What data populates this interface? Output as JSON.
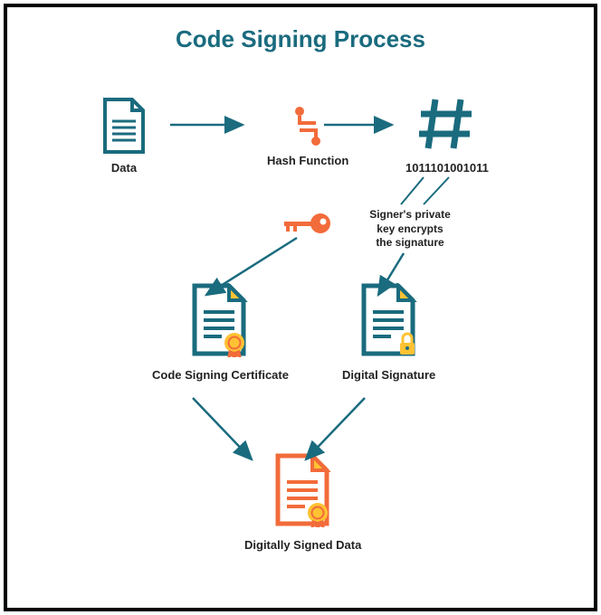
{
  "title": "Code Signing Process",
  "nodes": {
    "data": {
      "label": "Data"
    },
    "hash": {
      "label": "Hash Function"
    },
    "hashnum": {
      "label": "1011101001011"
    },
    "key": {
      "label": "Signer's private\nkey encrypts\nthe signature"
    },
    "cert": {
      "label": "Code Signing Certificate"
    },
    "sig": {
      "label": "Digital Signature"
    },
    "final": {
      "label": "Digitally Signed Data"
    }
  }
}
